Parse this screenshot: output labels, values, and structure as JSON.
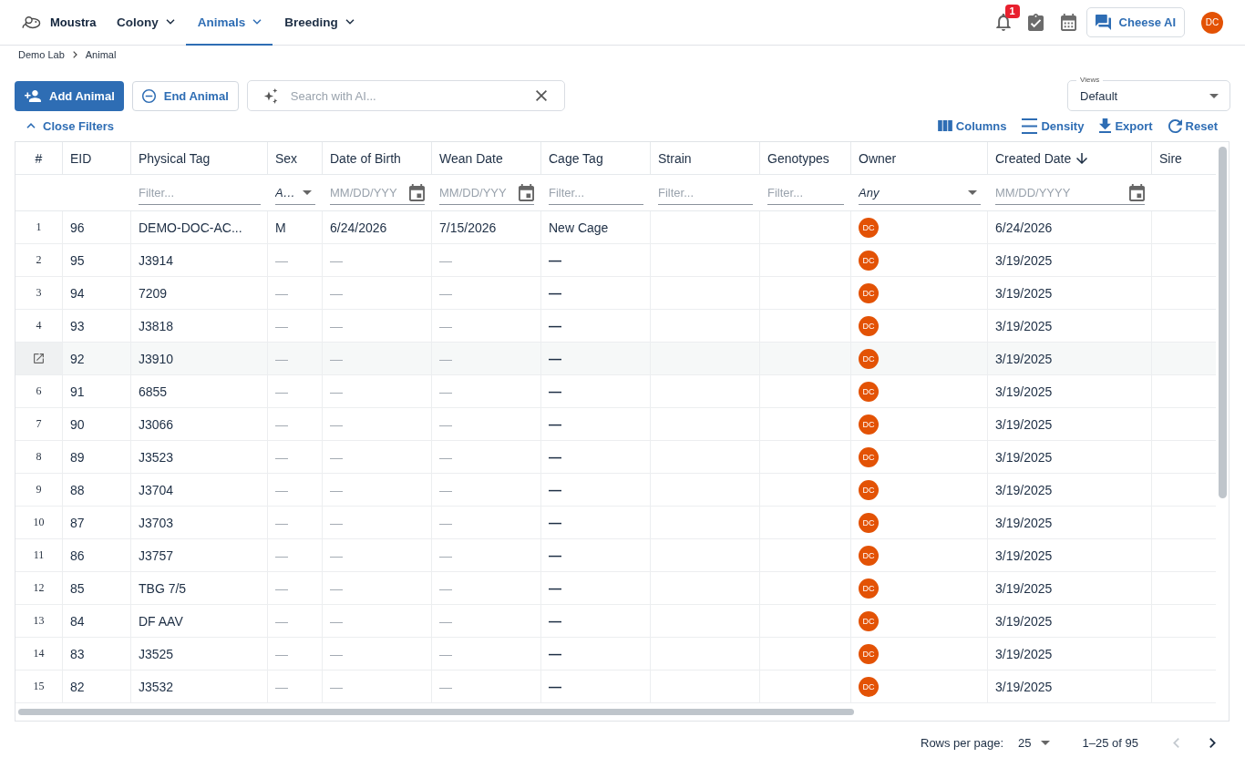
{
  "app": {
    "name": "Moustra"
  },
  "nav_tabs": [
    {
      "label": "Colony",
      "selected": false
    },
    {
      "label": "Animals",
      "selected": true
    },
    {
      "label": "Breeding",
      "selected": false
    }
  ],
  "header_actions": {
    "notifications_badge": "1",
    "assistant_button": "Cheese AI",
    "avatar": "DC"
  },
  "breadcrumb": [
    "Demo Lab",
    "Animal"
  ],
  "toolbar": {
    "buttons": [
      {
        "label": "Add Animal",
        "kind": "primary"
      },
      {
        "label": "End Animal",
        "kind": "outlined"
      }
    ],
    "search": {
      "placeholder": "Search with AI..."
    },
    "views": {
      "label": "Views",
      "value": "Default"
    }
  },
  "filters_toggle": {
    "label": "Close Filters",
    "expanded": true
  },
  "grid_actions": [
    {
      "label": "Columns",
      "kind": "columns"
    },
    {
      "label": "Density",
      "kind": "density"
    },
    {
      "label": "Export",
      "kind": "export"
    },
    {
      "label": "Reset",
      "kind": "reset"
    }
  ],
  "table": {
    "columns": [
      {
        "label": "#",
        "sorted": false
      },
      {
        "label": "EID",
        "sorted": false
      },
      {
        "label": "Physical Tag",
        "sorted": false,
        "filter": {
          "kind": "text",
          "placeholder": "Filter..."
        }
      },
      {
        "label": "Sex",
        "sorted": false,
        "filter": {
          "kind": "select",
          "value": "A…"
        }
      },
      {
        "label": "Date of Birth",
        "sorted": false,
        "filter": {
          "kind": "date",
          "placeholder": "MM/DD/YYY"
        }
      },
      {
        "label": "Wean Date",
        "sorted": false,
        "filter": {
          "kind": "date",
          "placeholder": "MM/DD/YYY"
        }
      },
      {
        "label": "Cage Tag",
        "sorted": false,
        "filter": {
          "kind": "text",
          "placeholder": "Filter..."
        }
      },
      {
        "label": "Strain",
        "sorted": false,
        "filter": {
          "kind": "text",
          "placeholder": "Filter..."
        }
      },
      {
        "label": "Genotypes",
        "sorted": false,
        "filter": {
          "kind": "text",
          "placeholder": "Filter..."
        }
      },
      {
        "label": "Owner",
        "sorted": false,
        "filter": {
          "kind": "select",
          "value": "Any"
        }
      },
      {
        "label": "Created Date",
        "sorted": true,
        "filter": {
          "kind": "date",
          "placeholder": "MM/DD/YYYY"
        }
      },
      {
        "label": "Sire",
        "sorted": false
      }
    ],
    "rows": [
      {
        "number": "1",
        "eid": "96",
        "physical_tag": "DEMO-DOC-AC...",
        "sex": "M",
        "date_of_birth": "6/24/2026",
        "wean_date": "7/15/2026",
        "cage_tag": "New Cage",
        "owner": "DC",
        "created_date": "6/24/2026",
        "unset": false,
        "hovered": false
      },
      {
        "number": "2",
        "eid": "95",
        "physical_tag": "J3914",
        "sex": "—",
        "date_of_birth": "—",
        "wean_date": "—",
        "cage_tag": "—",
        "owner": "DC",
        "created_date": "3/19/2025",
        "unset": true,
        "hovered": false
      },
      {
        "number": "3",
        "eid": "94",
        "physical_tag": "7209",
        "sex": "—",
        "date_of_birth": "—",
        "wean_date": "—",
        "cage_tag": "—",
        "owner": "DC",
        "created_date": "3/19/2025",
        "unset": true,
        "hovered": false
      },
      {
        "number": "4",
        "eid": "93",
        "physical_tag": "J3818",
        "sex": "—",
        "date_of_birth": "—",
        "wean_date": "—",
        "cage_tag": "—",
        "owner": "DC",
        "created_date": "3/19/2025",
        "unset": true,
        "hovered": false
      },
      {
        "eid": "92",
        "physical_tag": "J3910",
        "sex": "—",
        "date_of_birth": "—",
        "wean_date": "—",
        "cage_tag": "—",
        "owner": "DC",
        "created_date": "3/19/2025",
        "unset": true,
        "hovered": true
      },
      {
        "number": "6",
        "eid": "91",
        "physical_tag": "6855",
        "sex": "—",
        "date_of_birth": "—",
        "wean_date": "—",
        "cage_tag": "—",
        "owner": "DC",
        "created_date": "3/19/2025",
        "unset": true,
        "hovered": false
      },
      {
        "number": "7",
        "eid": "90",
        "physical_tag": "J3066",
        "sex": "—",
        "date_of_birth": "—",
        "wean_date": "—",
        "cage_tag": "—",
        "owner": "DC",
        "created_date": "3/19/2025",
        "unset": true,
        "hovered": false
      },
      {
        "number": "8",
        "eid": "89",
        "physical_tag": "J3523",
        "sex": "—",
        "date_of_birth": "—",
        "wean_date": "—",
        "cage_tag": "—",
        "owner": "DC",
        "created_date": "3/19/2025",
        "unset": true,
        "hovered": false
      },
      {
        "number": "9",
        "eid": "88",
        "physical_tag": "J3704",
        "sex": "—",
        "date_of_birth": "—",
        "wean_date": "—",
        "cage_tag": "—",
        "owner": "DC",
        "created_date": "3/19/2025",
        "unset": true,
        "hovered": false
      },
      {
        "number": "10",
        "eid": "87",
        "physical_tag": "J3703",
        "sex": "—",
        "date_of_birth": "—",
        "wean_date": "—",
        "cage_tag": "—",
        "owner": "DC",
        "created_date": "3/19/2025",
        "unset": true,
        "hovered": false
      },
      {
        "number": "11",
        "eid": "86",
        "physical_tag": "J3757",
        "sex": "—",
        "date_of_birth": "—",
        "wean_date": "—",
        "cage_tag": "—",
        "owner": "DC",
        "created_date": "3/19/2025",
        "unset": true,
        "hovered": false
      },
      {
        "number": "12",
        "eid": "85",
        "physical_tag": "TBG 7/5",
        "sex": "—",
        "date_of_birth": "—",
        "wean_date": "—",
        "cage_tag": "—",
        "owner": "DC",
        "created_date": "3/19/2025",
        "unset": true,
        "hovered": false
      },
      {
        "number": "13",
        "eid": "84",
        "physical_tag": "DF AAV",
        "sex": "—",
        "date_of_birth": "—",
        "wean_date": "—",
        "cage_tag": "—",
        "owner": "DC",
        "created_date": "3/19/2025",
        "unset": true,
        "hovered": false
      },
      {
        "number": "14",
        "eid": "83",
        "physical_tag": "J3525",
        "sex": "—",
        "date_of_birth": "—",
        "wean_date": "—",
        "cage_tag": "—",
        "owner": "DC",
        "created_date": "3/19/2025",
        "unset": true,
        "hovered": false
      },
      {
        "number": "15",
        "eid": "82",
        "physical_tag": "J3532",
        "sex": "—",
        "date_of_birth": "—",
        "wean_date": "—",
        "cage_tag": "—",
        "owner": "DC",
        "created_date": "3/19/2025",
        "unset": true,
        "hovered": false
      }
    ]
  },
  "pagination": {
    "rows_per_page_label": "Rows per page:",
    "rows_per_page": "25",
    "range": "1–25 of 95",
    "buttons": [
      {
        "kind": "previous",
        "disabled": true
      },
      {
        "kind": "next",
        "disabled": false
      }
    ]
  }
}
